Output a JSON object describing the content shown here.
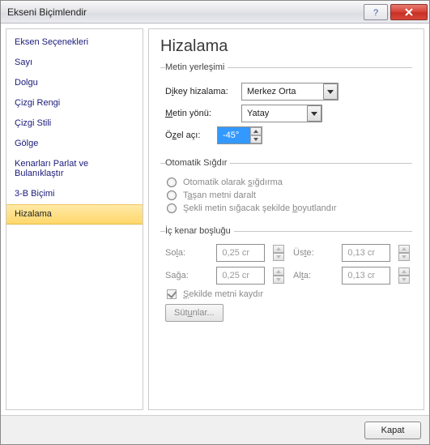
{
  "window": {
    "title": "Ekseni Biçimlendir"
  },
  "sidebar": {
    "items": [
      {
        "label": "Eksen Seçenekleri"
      },
      {
        "label": "Sayı"
      },
      {
        "label": "Dolgu"
      },
      {
        "label": "Çizgi Rengi"
      },
      {
        "label": "Çizgi Stili"
      },
      {
        "label": "Gölge"
      },
      {
        "label": "Kenarları Parlat ve Bulanıklaştır"
      },
      {
        "label": "3-B Biçimi"
      },
      {
        "label": "Hizalama"
      }
    ],
    "selected_index": 8
  },
  "pane": {
    "title": "Hizalama",
    "text_layout": {
      "legend": "Metin yerleşimi",
      "valign_label_pre": "D",
      "valign_label_u": "i",
      "valign_label_post": "key hizalama:",
      "valign_value": "Merkez Orta",
      "dir_label_pre": "",
      "dir_label_u": "M",
      "dir_label_post": "etin yönü:",
      "dir_value": "Yatay",
      "angle_label_pre": "Ö",
      "angle_label_u": "z",
      "angle_label_post": "el açı:",
      "angle_value": "-45°"
    },
    "autofit": {
      "legend": "Otomatik Sığdır",
      "opt1_pre": "Otomatik olarak ",
      "opt1_u": "s",
      "opt1_post": "ığdırma",
      "opt2_pre": "T",
      "opt2_u": "a",
      "opt2_post": "şan metni daralt",
      "opt3_pre": "Şekli metin sığacak şekilde ",
      "opt3_u": "b",
      "opt3_post": "oyutlandır"
    },
    "margins": {
      "legend": "İç kenar boşluğu",
      "left_label_pre": "So",
      "left_label_u": "l",
      "left_label_post": "a:",
      "left_value": "0,25 cm",
      "right_label_pre": "Sa",
      "right_label_u": "ğ",
      "right_label_post": "a:",
      "right_value": "0,25 cm",
      "top_label_pre": "Üs",
      "top_label_u": "t",
      "top_label_post": "e:",
      "top_value": "0,13 cm",
      "bottom_label_pre": "Al",
      "bottom_label_u": "t",
      "bottom_label_post": "a:",
      "bottom_value": "0,13 cm",
      "wrap_pre": "",
      "wrap_u": "Ş",
      "wrap_post": "ekilde metni kaydır",
      "columns_btn_pre": "Süt",
      "columns_btn_u": "u",
      "columns_btn_post": "nlar..."
    }
  },
  "footer": {
    "close": "Kapat"
  }
}
